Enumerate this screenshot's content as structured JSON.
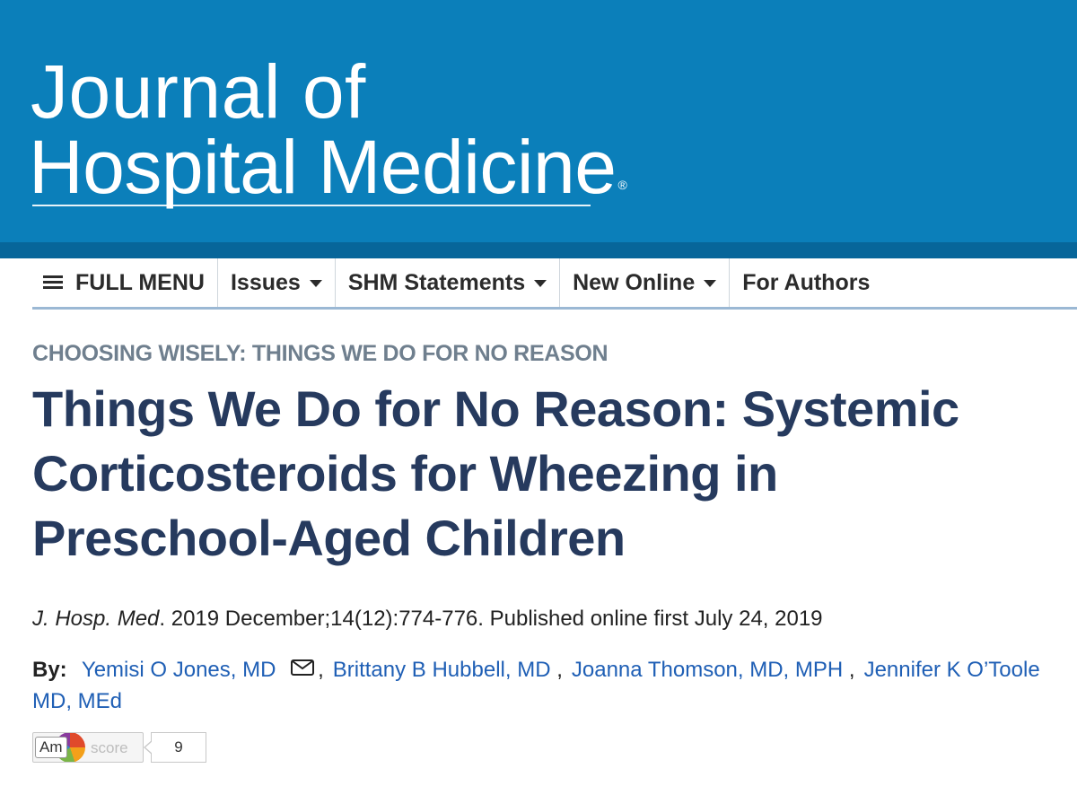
{
  "masthead": {
    "logo_line1": "Journal of",
    "logo_line2": "Hospital Medicine",
    "logo_reg": "®",
    "background_color": "#0b7fba"
  },
  "nav": {
    "full_menu": "FULL MENU",
    "items": [
      {
        "label": "Issues",
        "dropdown": true
      },
      {
        "label": "SHM Statements",
        "dropdown": true
      },
      {
        "label": "New Online",
        "dropdown": true
      },
      {
        "label": "For Authors",
        "dropdown": false
      }
    ]
  },
  "article": {
    "kicker": "CHOOSING WISELY: THINGS WE DO FOR NO REASON",
    "title": "Things We Do for No Reason: Systemic Corticosteroids for Wheezing in Preschool-Aged Children",
    "citation": {
      "journal": "J. Hosp. Med",
      "rest": ". 2019 December;14(12):774-776. Published online first July 24, 2019"
    },
    "byline": {
      "by_label": "By:",
      "authors": [
        "Yemisi O Jones, MD",
        "Brittany B Hubbell, MD",
        "Joanna Thomson, MD, MPH",
        "Jennifer K O’Toole MD, MEd"
      ],
      "separators": [
        ",",
        ",",
        ","
      ]
    }
  },
  "altmetric": {
    "badge_label": "Am",
    "score_word": "score",
    "score": "9"
  },
  "colors": {
    "title": "#263a5e",
    "kicker": "#6f7f8e",
    "author_link": "#1f5fb5",
    "nav_rule": "#9bb8d4"
  },
  "icons": {
    "menu": "hamburger-icon",
    "dropdown": "caret-down-icon",
    "email": "envelope-icon"
  }
}
